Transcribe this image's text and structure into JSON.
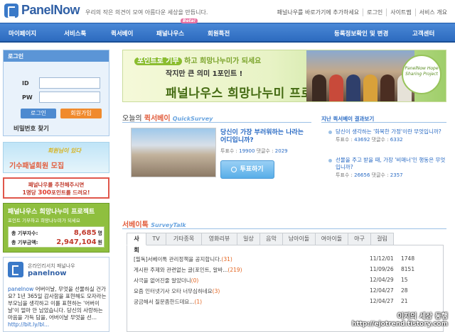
{
  "header": {
    "logo": "PanelNow",
    "slogan": "우리의 작은 의견이 모여 아름다운 세상을 만듭니다.",
    "links": [
      "패널나우를 바로가기에 추가하세요",
      "로그인",
      "사이트맵",
      "서비스 개요"
    ]
  },
  "nav": {
    "items": [
      "마이페이지",
      "서비스툭",
      "퀵서베이",
      "패널나우스",
      "회원특전",
      "등록정보확인 및 변경",
      "고객센터"
    ],
    "beta": "Beta!"
  },
  "login": {
    "title": "로그인",
    "id_label": "ID",
    "pw_label": "PW",
    "login_button": "로그인",
    "join_button": "회원가입",
    "find_password": "비밀번호 찾기"
  },
  "event_banner": {
    "script_text": "회원님이 있다",
    "main_text": "기수패널회원 모집"
  },
  "recommend": {
    "line1": "패널나우를 추천해주시면",
    "line2_prefix": "1명당 ",
    "line2_points": "300",
    "line2_suffix": "포인트를 드려요!"
  },
  "project": {
    "title": "패널나우스 희망나누미 프로젝트",
    "subtitle": "포인트 기부하고 희망나누미가 되세요",
    "donors_label": "총 기부자수:",
    "donors_value": "8,685",
    "donors_unit": "명",
    "amount_label": "총 기부금액:",
    "amount_value": "2,947,104",
    "amount_unit": "원"
  },
  "twitter": {
    "line1": "온라인리서치 패널나우",
    "handle": "panelnow",
    "user": "panelnow",
    "body": " 어버이날, 무엇을 선물하실 건가요? 1년 365일 감사함을 표현해도 모자라는 부모님을 생각하고 이를 표현하는 '어버이날'이 얼마 안 남았습니다. 당신의 사랑하는 마음을 가득 담을, 어버이날 무엇을 선...",
    "link": "http://bit.ly/bl..."
  },
  "hero": {
    "line1_pill": "포인트로 기부",
    "line1_rest": "하고 희망나누미가 되세요",
    "line2": "작지만 큰 의미 1포인트 !",
    "line3": "패널나우스 희망나누미 프로젝트",
    "badge": "PanelNow Hope Sharing Project"
  },
  "quicksurvey": {
    "title_prefix": "오늘의 ",
    "title_em": "퀵서베이",
    "title_en": "QuickSurvey",
    "question": "당신이 가장 부러워하는 나라는 어디입니까?",
    "votes_label": "투표수 : ",
    "votes": "19900",
    "comments_label": " 댓글수 : ",
    "comments": "2029",
    "vote_button": "투표하기"
  },
  "past_results": {
    "title": "지난 퀵서베이 결과보기",
    "items": [
      {
        "question": "당신이 생각하는 '화목한 가정'이란 무엇입니까?",
        "votes": "43692",
        "comments": "6332"
      },
      {
        "question": "선물을 주고 받을 때, 가장 '비매너'인 행동은 무엇입니까?",
        "votes": "26656",
        "comments": "2357"
      }
    ],
    "votes_label": "투표수 : ",
    "comments_label": " 댓글수 : "
  },
  "surveytalk": {
    "title": "서베이톡",
    "title_en": "SurveyTalk",
    "tabs": [
      "사회",
      "TV",
      "기타종목",
      "영화리뷰",
      "일상",
      "음악",
      "남아이돌",
      "여아이돌",
      "야구",
      "걸림"
    ],
    "posts": [
      {
        "title": "[필독]서베이톡 관리정책을 공지합니다.",
        "count": "(31)",
        "date": "11/12/01",
        "views": "1748"
      },
      {
        "title": "게시판 주제와 관련없는 글(포인트, 알바...",
        "count": "(219)",
        "date": "11/09/26",
        "views": "8151"
      },
      {
        "title": "사극을 없어진줄 알았더니",
        "count": "(0)",
        "date": "12/04/29",
        "views": "15"
      },
      {
        "title": "요즘 인터넷기사 오타 너무심하네요",
        "count": "(3)",
        "date": "12/04/27",
        "views": "28"
      },
      {
        "title": "궁금해서 질문좀한드데요...",
        "count": "(1)",
        "date": "12/04/27",
        "views": "21"
      }
    ]
  },
  "watermark": {
    "line1": "이지의 세상 동행",
    "line2": "http://ejotrend.tistory.com"
  },
  "colors": {
    "brand_blue": "#2f5fa5",
    "nav_blue": "#3a79c8",
    "accent_orange": "#f08a2c",
    "project_green": "#8fbf3f"
  }
}
